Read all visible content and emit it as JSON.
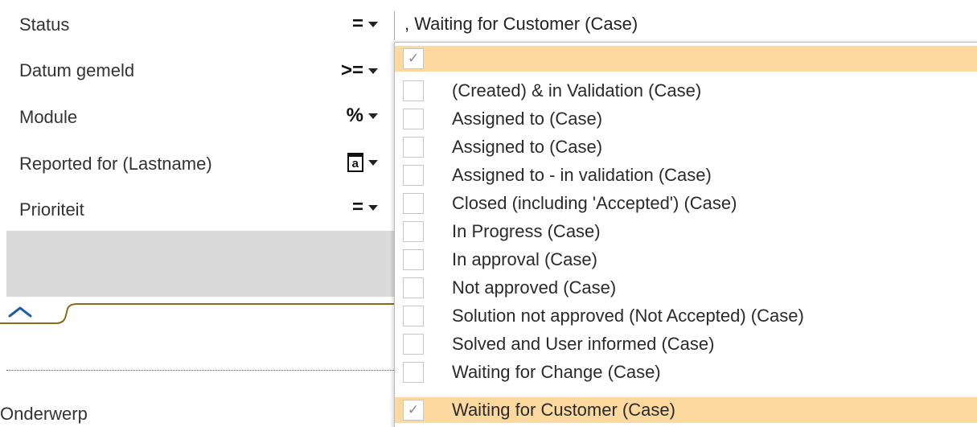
{
  "filters": [
    {
      "label": "Status",
      "operator": "=",
      "operator_icon": "equals-icon"
    },
    {
      "label": "Datum gemeld",
      "operator": ">=",
      "operator_icon": "greater-equal-icon"
    },
    {
      "label": "Module",
      "operator": "%",
      "operator_icon": "percent-icon"
    },
    {
      "label": "Reported for (Lastname)",
      "operator": "a",
      "operator_icon": "text-box-icon"
    },
    {
      "label": "Prioriteit",
      "operator": "=",
      "operator_icon": "equals-icon"
    }
  ],
  "status_field": {
    "value": ", Waiting for Customer (Case)"
  },
  "status_options": [
    {
      "label": "",
      "checked": true,
      "highlighted": true
    },
    {
      "label": "(Created) & in Validation (Case)",
      "checked": false,
      "highlighted": false
    },
    {
      "label": "Assigned to (Case)",
      "checked": false,
      "highlighted": false
    },
    {
      "label": "Assigned to (Case)",
      "checked": false,
      "highlighted": false
    },
    {
      "label": "Assigned to - in validation (Case)",
      "checked": false,
      "highlighted": false
    },
    {
      "label": "Closed (including 'Accepted') (Case)",
      "checked": false,
      "highlighted": false
    },
    {
      "label": "In Progress (Case)",
      "checked": false,
      "highlighted": false
    },
    {
      "label": "In approval (Case)",
      "checked": false,
      "highlighted": false
    },
    {
      "label": "Not approved (Case)",
      "checked": false,
      "highlighted": false
    },
    {
      "label": "Solution not approved (Not Accepted) (Case)",
      "checked": false,
      "highlighted": false
    },
    {
      "label": "Solved and User informed (Case)",
      "checked": false,
      "highlighted": false
    },
    {
      "label": "Waiting for Change (Case)",
      "checked": false,
      "highlighted": false
    },
    {
      "label": "Waiting for Customer (Case)",
      "checked": true,
      "highlighted": true
    }
  ],
  "section": {
    "field_label": "Onderwerp"
  },
  "colors": {
    "highlight": "#fdd9a0",
    "tab_line": "#8b6a1e",
    "collapse_icon": "#1f5fa8",
    "gray_band": "#dadada"
  }
}
